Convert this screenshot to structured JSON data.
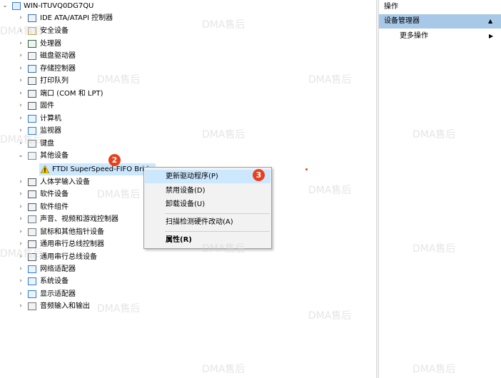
{
  "tree": {
    "root_label": "WIN-ITUVQ0DG7QU",
    "categories": [
      {
        "label": "IDE ATA/ATAPI 控制器",
        "icon": "ide-controller-icon"
      },
      {
        "label": "安全设备",
        "icon": "security-device-icon"
      },
      {
        "label": "处理器",
        "icon": "processor-icon"
      },
      {
        "label": "磁盘驱动器",
        "icon": "disk-drive-icon"
      },
      {
        "label": "存储控制器",
        "icon": "storage-controller-icon"
      },
      {
        "label": "打印队列",
        "icon": "printer-icon"
      },
      {
        "label": "端口 (COM 和 LPT)",
        "icon": "port-icon"
      },
      {
        "label": "固件",
        "icon": "firmware-icon"
      },
      {
        "label": "计算机",
        "icon": "computer-icon"
      },
      {
        "label": "监视器",
        "icon": "monitor-icon"
      },
      {
        "label": "键盘",
        "icon": "keyboard-icon"
      },
      {
        "label": "其他设备",
        "icon": "other-devices-icon"
      },
      {
        "label": "人体学输入设备",
        "icon": "hid-icon"
      },
      {
        "label": "软件设备",
        "icon": "software-device-icon"
      },
      {
        "label": "软件组件",
        "icon": "software-component-icon"
      },
      {
        "label": "声音、视频和游戏控制器",
        "icon": "sound-icon"
      },
      {
        "label": "鼠标和其他指针设备",
        "icon": "mouse-icon"
      },
      {
        "label": "通用串行总线控制器",
        "icon": "usb-icon"
      },
      {
        "label": "通用串行总线设备",
        "icon": "usb-device-icon"
      },
      {
        "label": "网络适配器",
        "icon": "network-adapter-icon"
      },
      {
        "label": "系统设备",
        "icon": "system-device-icon"
      },
      {
        "label": "显示适配器",
        "icon": "display-adapter-icon"
      },
      {
        "label": "音频输入和输出",
        "icon": "audio-io-icon"
      }
    ],
    "selected_device": "FTDI SuperSpeed-FIFO Bridge"
  },
  "step_badges": {
    "device": "2",
    "menu": "3"
  },
  "context_menu": {
    "update_driver": "更新驱动程序(P)",
    "disable": "禁用设备(D)",
    "uninstall": "卸载设备(U)",
    "scan": "扫描检测硬件改动(A)",
    "properties": "属性(R)"
  },
  "actions_pane": {
    "header": "操作",
    "section": "设备管理器",
    "more": "更多操作"
  },
  "watermark_text": "DMA售后",
  "colors": {
    "selection": "#cce8ff",
    "badge": "#e8401c",
    "pane_selected": "#a8c8e8"
  }
}
